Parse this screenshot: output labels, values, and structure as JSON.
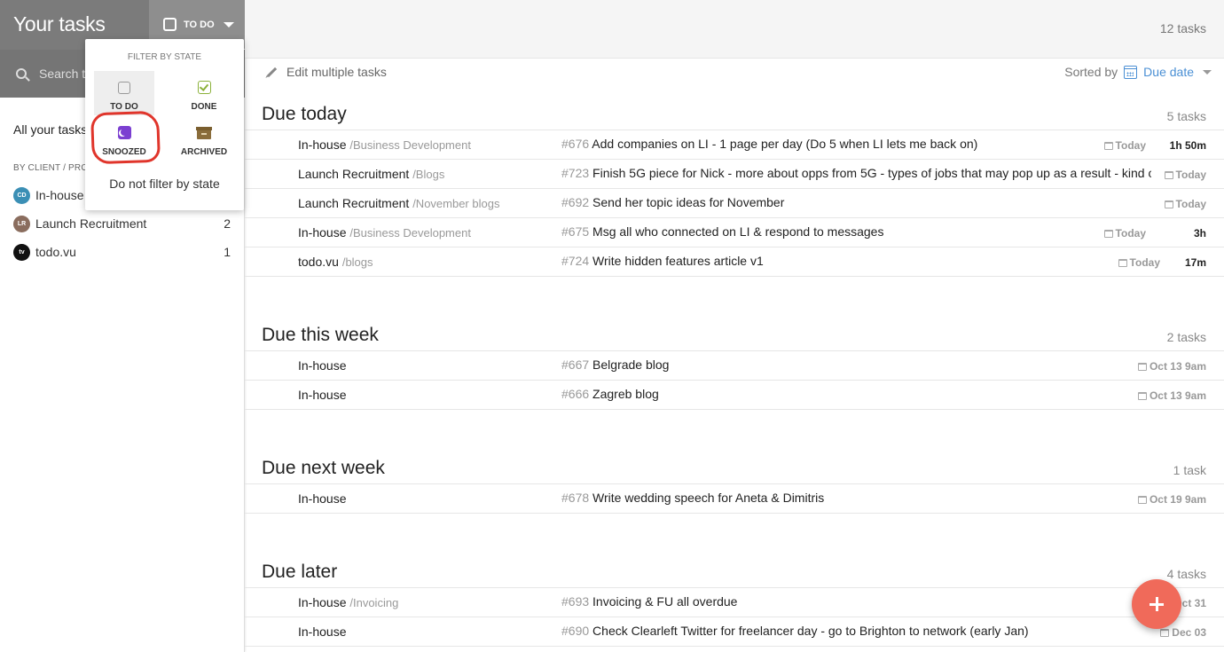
{
  "sidebar": {
    "title": "Your tasks",
    "state_button": "TO DO",
    "search_placeholder": "Search t",
    "all_tasks": "All your tasks",
    "by_client": "BY CLIENT / PRO",
    "clients": [
      {
        "initials": "CD",
        "name": "In-house",
        "count": "",
        "color": "#3b8fb5"
      },
      {
        "initials": "LR",
        "name": "Launch Recruitment",
        "count": "2",
        "color": "#8a6d5e"
      },
      {
        "initials": "tv",
        "name": "todo.vu",
        "count": "1",
        "color": "#111111"
      }
    ]
  },
  "dropdown": {
    "title": "FILTER BY STATE",
    "items": [
      {
        "label": "TO DO",
        "icon": "checkbox-empty-icon"
      },
      {
        "label": "DONE",
        "icon": "checkbox-checked-icon"
      },
      {
        "label": "SNOOZED",
        "icon": "snooze-moon-icon"
      },
      {
        "label": "ARCHIVED",
        "icon": "archive-box-icon"
      }
    ],
    "no_filter": "Do not filter by state"
  },
  "topbar": {
    "count": "12 tasks"
  },
  "toolbar": {
    "edit_multiple": "Edit multiple tasks",
    "sorted_by": "Sorted by",
    "sort_value": "Due date"
  },
  "sections": [
    {
      "title": "Due today",
      "count": "5 tasks",
      "rows": [
        {
          "client": "In-house",
          "project": "/Business Development",
          "num": "#676",
          "task": "Add companies on LI - 1 page per day (Do 5 when LI lets me back on)",
          "due": "Today",
          "duration": "1h 50m"
        },
        {
          "client": "Launch Recruitment",
          "project": "/Blogs",
          "num": "#723",
          "task": "Finish 5G piece for Nick - more about opps from 5G - types of jobs that may pop up as a result - kind o",
          "due": "Today",
          "duration": ""
        },
        {
          "client": "Launch Recruitment",
          "project": "/November blogs",
          "num": "#692",
          "task": "Send her topic ideas for November",
          "due": "Today",
          "duration": ""
        },
        {
          "client": "In-house",
          "project": "/Business Development",
          "num": "#675",
          "task": "Msg all who connected on LI & respond to messages",
          "due": "Today",
          "duration": "3h"
        },
        {
          "client": "todo.vu",
          "project": "/blogs",
          "num": "#724",
          "task": "Write hidden features article v1",
          "due": "Today",
          "duration": "17m"
        }
      ]
    },
    {
      "title": "Due this week",
      "count": "2 tasks",
      "rows": [
        {
          "client": "In-house",
          "project": "",
          "num": "#667",
          "task": "Belgrade blog",
          "due": "Oct 13 9am",
          "duration": ""
        },
        {
          "client": "In-house",
          "project": "",
          "num": "#666",
          "task": "Zagreb blog",
          "due": "Oct 13 9am",
          "duration": ""
        }
      ]
    },
    {
      "title": "Due next week",
      "count": "1 task",
      "rows": [
        {
          "client": "In-house",
          "project": "",
          "num": "#678",
          "task": "Write wedding speech for Aneta & Dimitris",
          "due": "Oct 19 9am",
          "duration": ""
        }
      ]
    },
    {
      "title": "Due later",
      "count": "4 tasks",
      "rows": [
        {
          "client": "In-house",
          "project": "/Invoicing",
          "num": "#693",
          "task": "Invoicing & FU all overdue",
          "due": "Oct 31",
          "duration": ""
        },
        {
          "client": "In-house",
          "project": "",
          "num": "#690",
          "task": "Check Clearleft Twitter for freelancer day - go to Brighton to network (early Jan)",
          "due": "Dec 03",
          "duration": ""
        }
      ]
    }
  ],
  "colors": {
    "accent": "#4a8fd4",
    "fab": "#f06a5a",
    "annotation": "#e0352b"
  }
}
